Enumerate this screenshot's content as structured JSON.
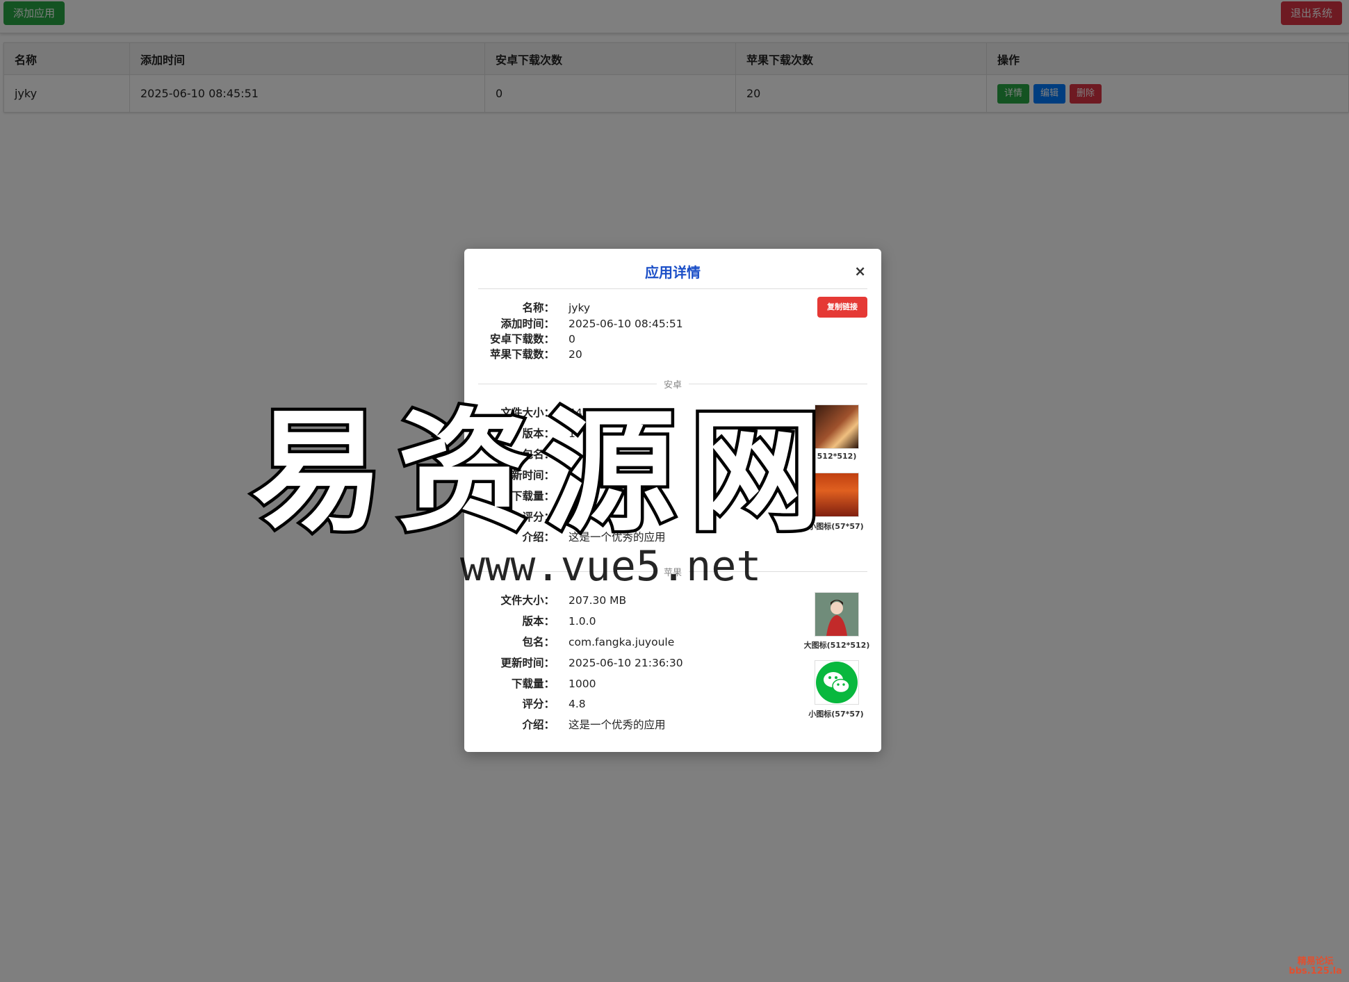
{
  "topbar": {
    "add_label": "添加应用",
    "logout_label": "退出系统"
  },
  "table": {
    "headers": [
      "名称",
      "添加时间",
      "安卓下载次数",
      "苹果下载次数",
      "操作"
    ],
    "rows": [
      {
        "name": "jyky",
        "added": "2025-06-10 08:45:51",
        "android_downloads": "0",
        "ios_downloads": "20"
      }
    ],
    "actions": {
      "detail": "详情",
      "edit": "编辑",
      "delete": "删除"
    }
  },
  "modal": {
    "title": "应用详情",
    "close": "×",
    "copy_link": "复制链接",
    "summary": [
      {
        "label": "名称：",
        "value": "jyky"
      },
      {
        "label": "添加时间：",
        "value": "2025-06-10 08:45:51"
      },
      {
        "label": "安卓下载数：",
        "value": "0"
      },
      {
        "label": "苹果下载数：",
        "value": "20"
      }
    ],
    "android": {
      "section": "安卓",
      "fields": [
        {
          "label": "文件大小：",
          "value": "449.60 MB"
        },
        {
          "label": "版本：",
          "value": "1"
        },
        {
          "label": "包名：",
          "value": ""
        },
        {
          "label": "更新时间：",
          "value": "30"
        },
        {
          "label": "下载量：",
          "value": ""
        },
        {
          "label": "评分：",
          "value": "4.5"
        },
        {
          "label": "介绍：",
          "value": "这是一个优秀的应用"
        }
      ],
      "large_icon_caption": "512*512)",
      "small_icon_caption": "小图标(57*57)"
    },
    "ios": {
      "section": "苹果",
      "fields": [
        {
          "label": "文件大小：",
          "value": "207.30 MB"
        },
        {
          "label": "版本：",
          "value": "1.0.0"
        },
        {
          "label": "包名：",
          "value": "com.fangka.juyoule"
        },
        {
          "label": "更新时间：",
          "value": "2025-06-10 21:36:30"
        },
        {
          "label": "下载量：",
          "value": "1000"
        },
        {
          "label": "评分：",
          "value": "4.8"
        },
        {
          "label": "介绍：",
          "value": "这是一个优秀的应用"
        }
      ],
      "large_icon_caption": "大图标(512*512)",
      "small_icon_caption": "小图标(57*57)"
    }
  },
  "watermark": {
    "big_text": "易资源网",
    "url_text": "www.vue5.net"
  },
  "corner_mark": {
    "line1": "精易论坛",
    "line2": "bbs.125.la"
  },
  "colors": {
    "accent_blue": "#1a4ec7",
    "green": "#28a745",
    "red": "#dc3545",
    "blue": "#007bff"
  }
}
